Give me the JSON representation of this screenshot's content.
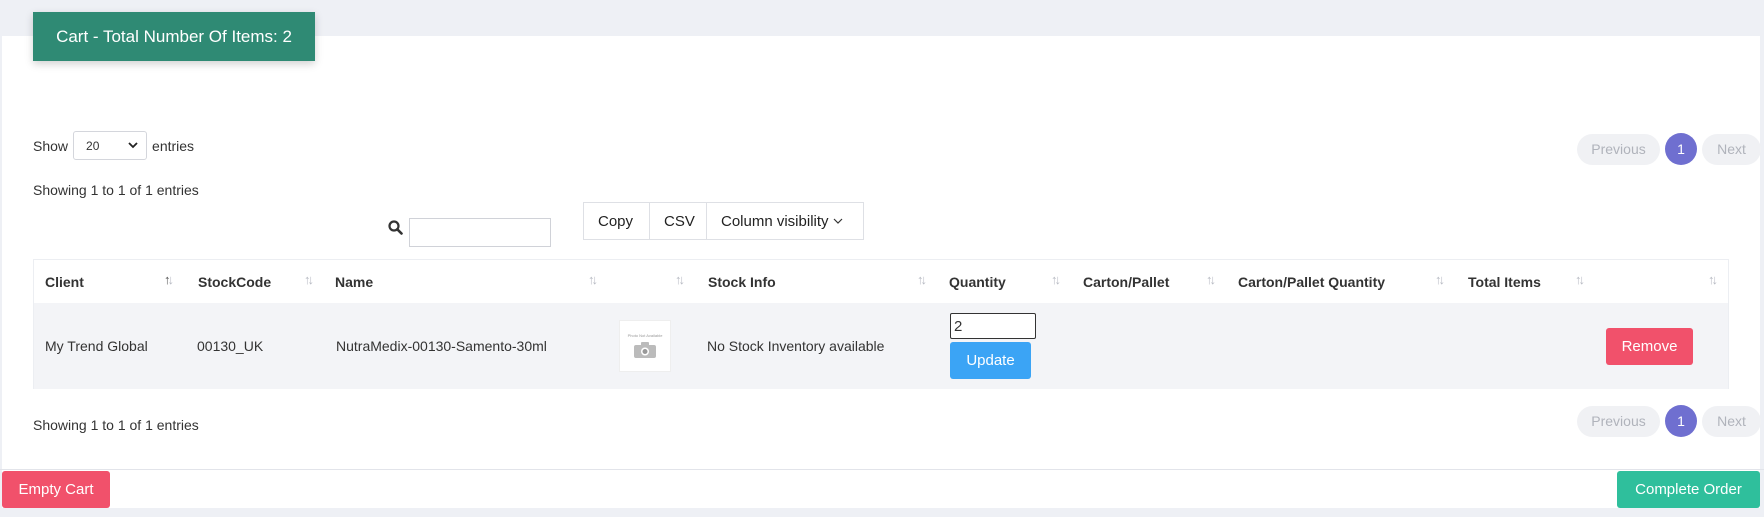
{
  "header": {
    "title": "Cart - Total Number Of Items: 2"
  },
  "length_menu": {
    "prefix": "Show",
    "selected": "20",
    "suffix": "entries"
  },
  "info_top": "Showing 1 to 1 of 1 entries",
  "info_bottom": "Showing 1 to 1 of 1 entries",
  "pagination": {
    "previous": "Previous",
    "current": "1",
    "next": "Next"
  },
  "toolbar": {
    "copy": "Copy",
    "csv": "CSV",
    "column_visibility": "Column visibility"
  },
  "columns": [
    "Client",
    "StockCode",
    "Name",
    "",
    "Stock Info",
    "Quantity",
    "Carton/Pallet",
    "Carton/Pallet Quantity",
    "Total Items",
    ""
  ],
  "rows": [
    {
      "client": "My Trend Global",
      "stockcode": "00130_UK",
      "name": "NutraMedix-00130-Samento-30ml",
      "image_text": "Photo Not Available",
      "stock_info": "No Stock Inventory available",
      "quantity": "2",
      "carton_pallet": "",
      "carton_pallet_quantity": "",
      "total_items": "",
      "update_label": "Update",
      "remove_label": "Remove"
    }
  ],
  "actions": {
    "empty_cart": "Empty Cart",
    "complete_order": "Complete Order"
  },
  "icons": {
    "search": "search-icon",
    "chevron": "chevron-down-icon",
    "sort": "sort-icon",
    "photo": "camera-placeholder-icon"
  },
  "colors": {
    "header": "#2f8a74",
    "danger": "#f1516b",
    "primary": "#3ba4f5",
    "success": "#2fbf9c",
    "page_active": "#6f6fd0"
  }
}
